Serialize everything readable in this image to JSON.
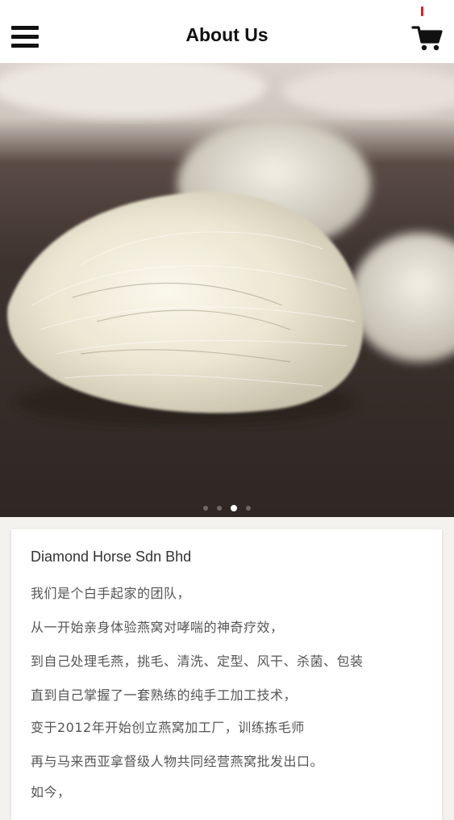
{
  "header": {
    "title": "About Us",
    "menu_icon": "hamburger-menu-icon",
    "cart_icon": "shopping-cart-icon",
    "badge_color": "#e0201c"
  },
  "carousel": {
    "slide_count": 4,
    "active_index": 2
  },
  "about": {
    "company": "Diamond Horse Sdn Bhd",
    "lines": [
      "我们是个白手起家的团队，",
      "从一开始亲身体验燕窝对哮喘的神奇疗效，",
      "到自己处理毛燕，挑毛、清洗、定型、风干、杀菌、包装",
      "直到自己掌握了一套熟练的纯手工加工技术，",
      "变于2012年开始创立燕窝加工厂，训练拣毛师",
      "再与马来西亚拿督级人物共同经营燕窝批发出口。",
      "如今，"
    ]
  }
}
